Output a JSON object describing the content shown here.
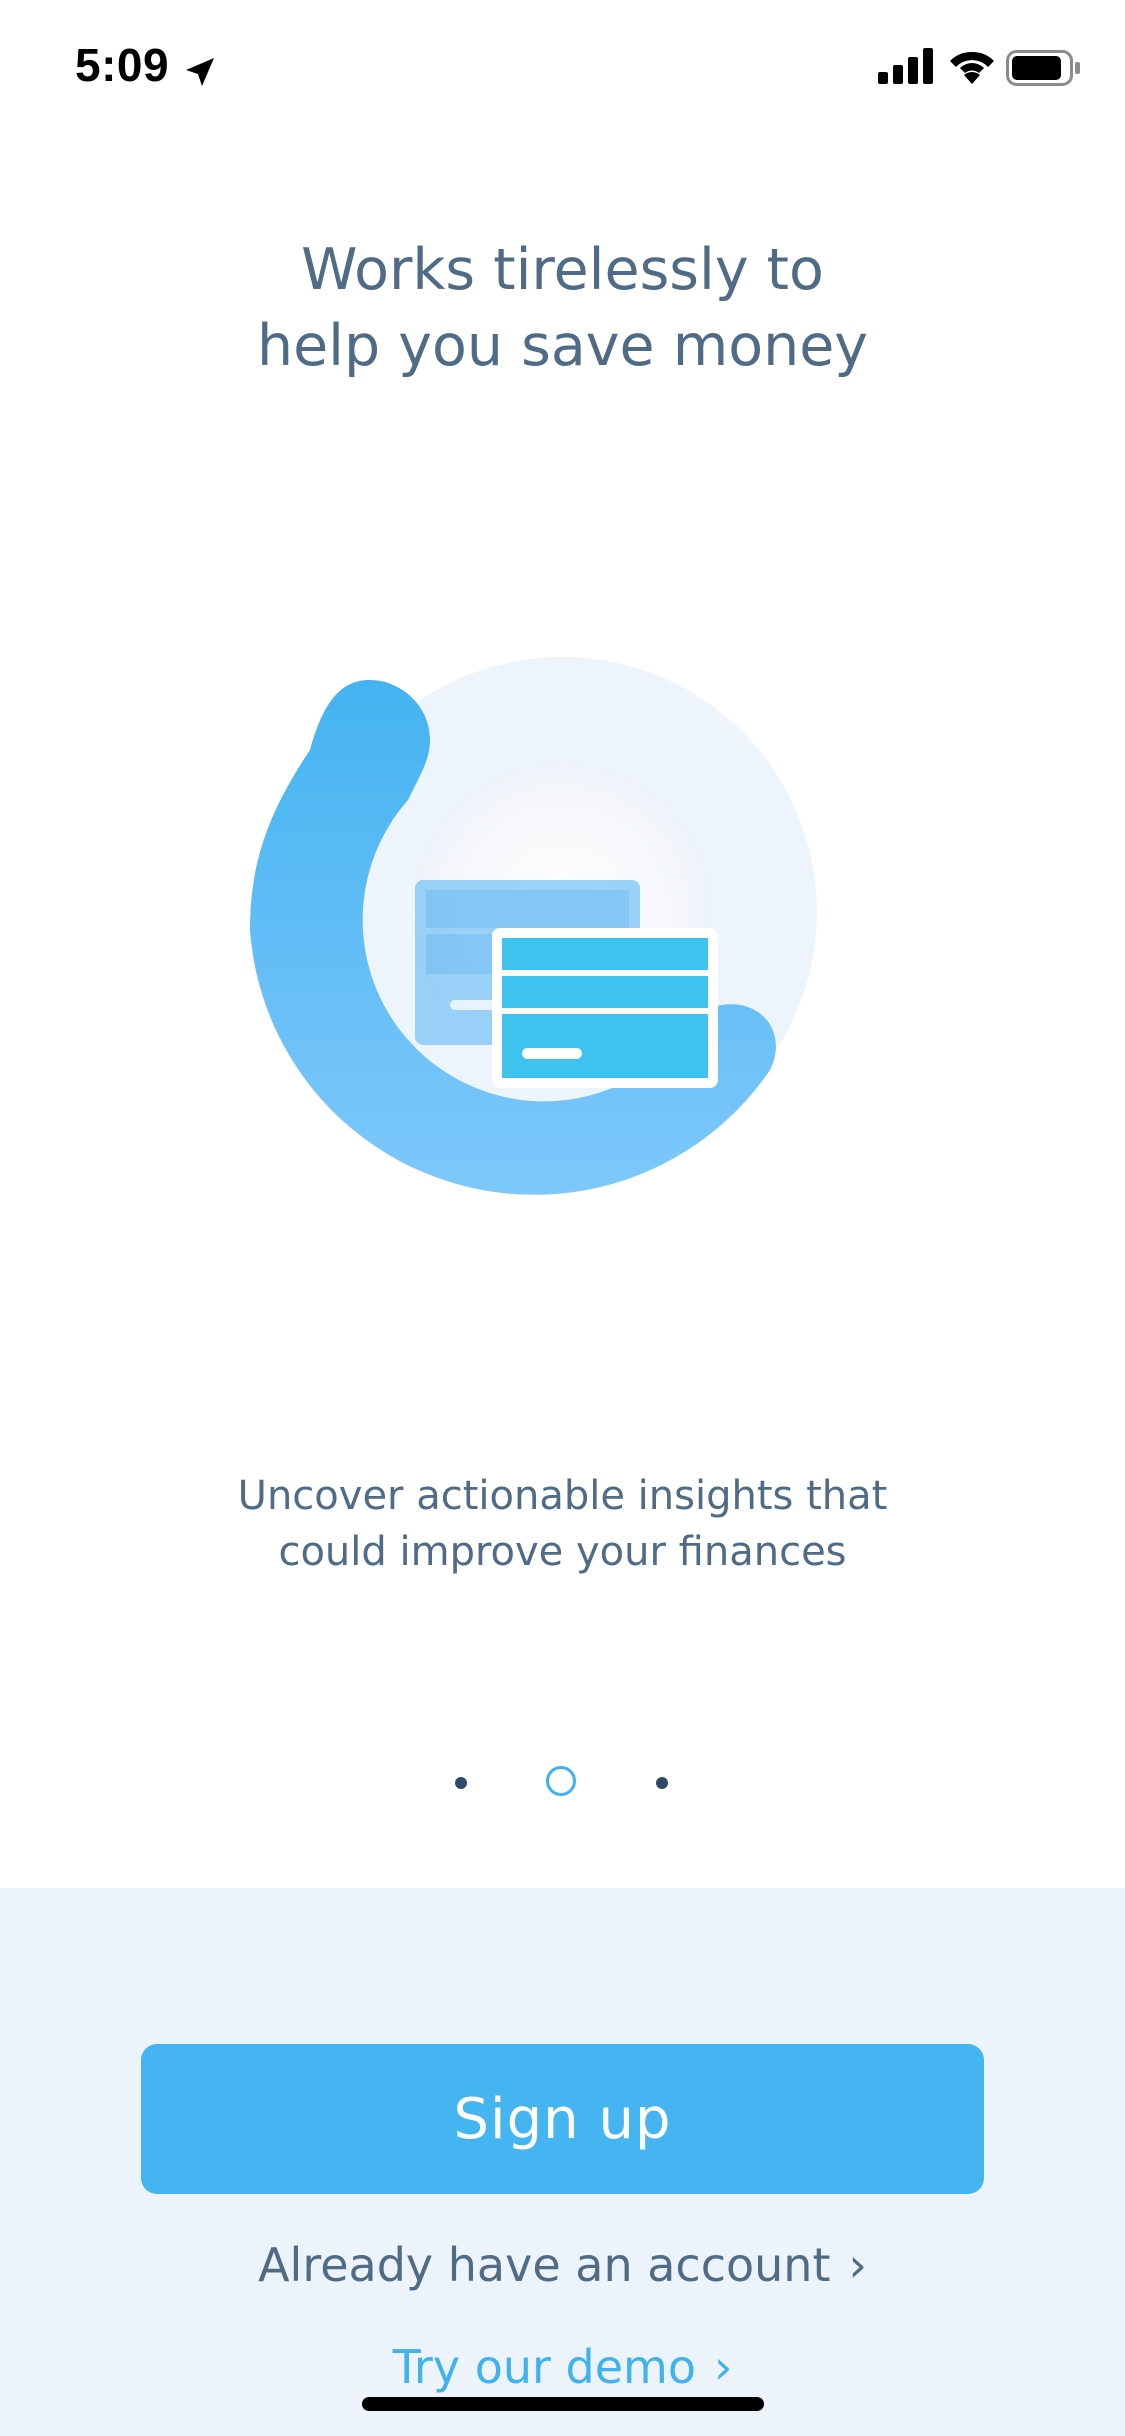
{
  "status_bar": {
    "time": "5:09",
    "icons": [
      "location-arrow-icon",
      "cellular-signal-icon",
      "wifi-icon",
      "battery-icon"
    ]
  },
  "onboarding": {
    "title": "Works tirelessly to\nhelp you save money",
    "subtitle": "Uncover actionable insights that\ncould improve your finances",
    "page_indicator": {
      "total": 3,
      "current": 2
    }
  },
  "actions": {
    "signup_label": "Sign up",
    "account_label": "Already have an account",
    "demo_label": "Try our demo",
    "chevron": "›"
  },
  "colors": {
    "accent": "#45b5f2",
    "text": "#4f6b86",
    "panel": "#edf3fa"
  }
}
